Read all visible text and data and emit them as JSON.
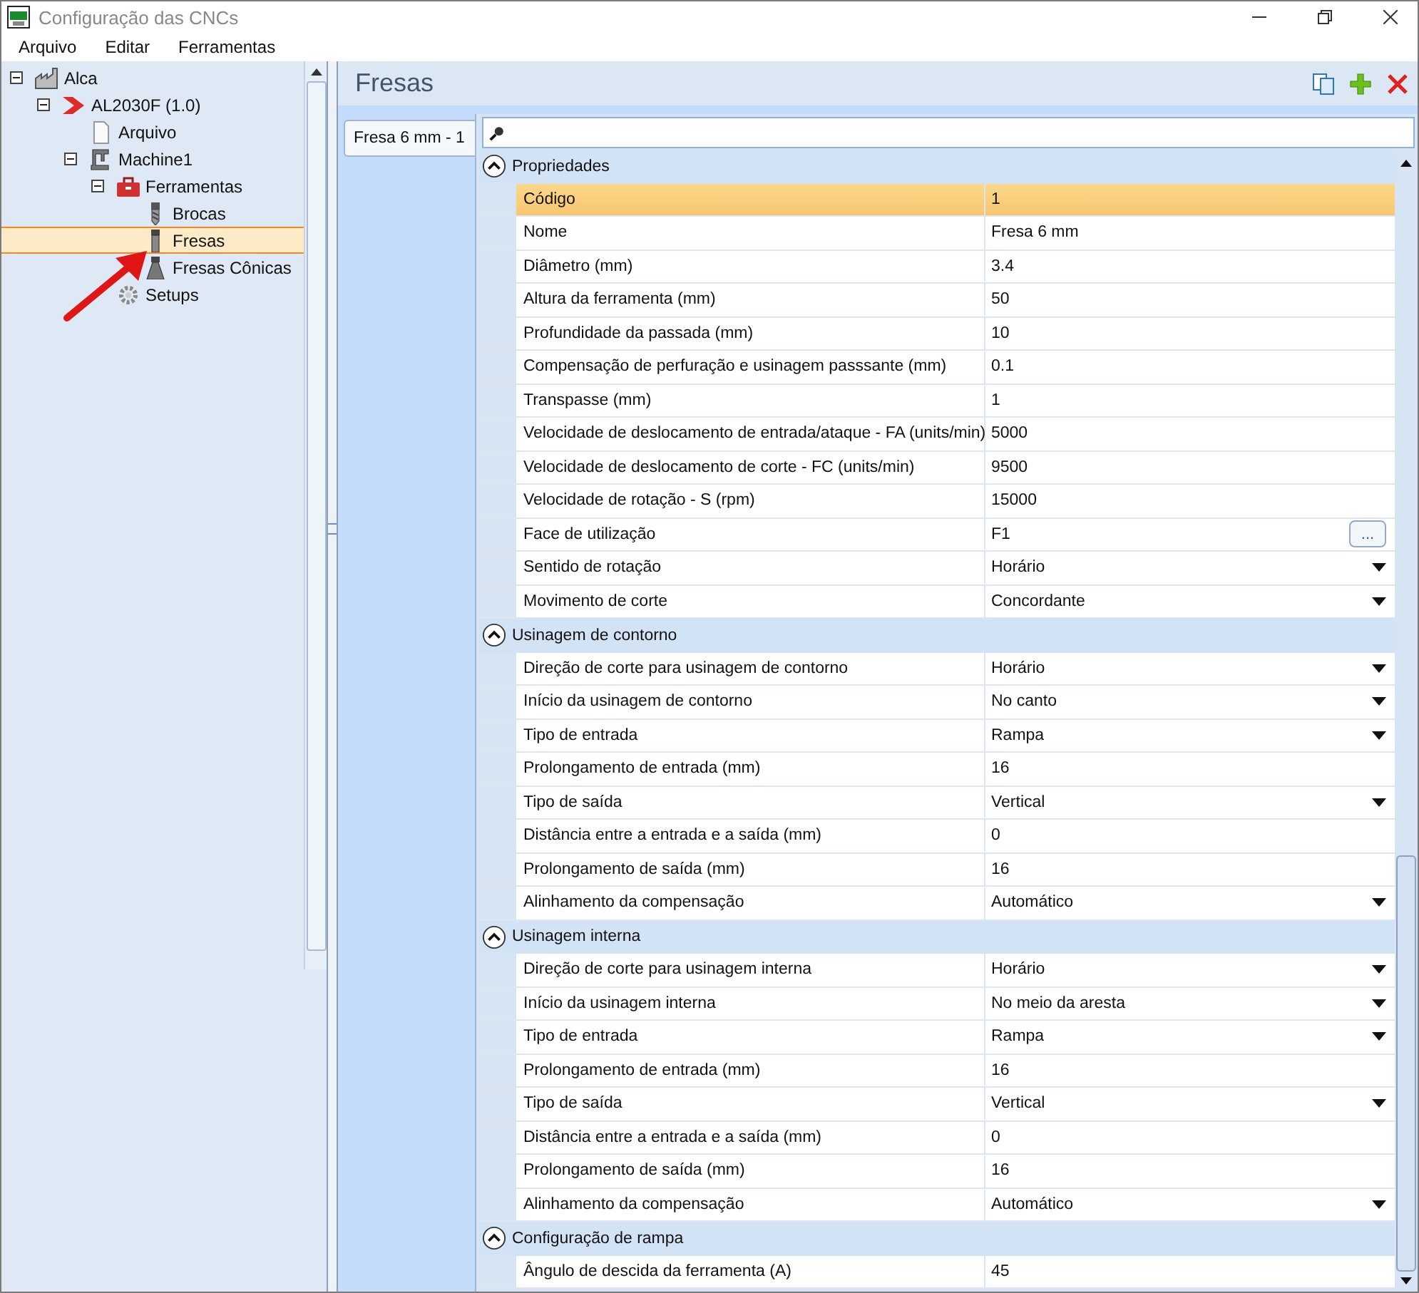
{
  "window": {
    "title": "Configuração das CNCs"
  },
  "menu": [
    "Arquivo",
    "Editar",
    "Ferramentas"
  ],
  "tree": [
    {
      "label": "Alca",
      "kind": "factory",
      "expanded": true,
      "selected": false,
      "children": [
        {
          "label": "AL2030F (1.0)",
          "kind": "chevron",
          "expanded": true,
          "selected": false,
          "children": [
            {
              "label": "Arquivo",
              "kind": "file",
              "selected": false
            },
            {
              "label": "Machine1",
              "kind": "machine",
              "expanded": true,
              "selected": false,
              "children": [
                {
                  "label": "Ferramentas",
                  "kind": "toolbox",
                  "expanded": true,
                  "selected": false,
                  "children": [
                    {
                      "label": "Brocas",
                      "kind": "drill",
                      "selected": false
                    },
                    {
                      "label": "Fresas",
                      "kind": "mill",
                      "selected": true
                    },
                    {
                      "label": "Fresas Cônicas",
                      "kind": "conical",
                      "selected": false
                    }
                  ]
                },
                {
                  "label": "Setups",
                  "kind": "gear",
                  "selected": false
                }
              ]
            }
          ]
        }
      ]
    }
  ],
  "panel": {
    "title": "Fresas",
    "tabs": [
      {
        "label": "Fresa 6 mm - 1",
        "selected": true
      }
    ]
  },
  "grid": {
    "sections": [
      {
        "title": "Propriedades",
        "expanded": true,
        "rows": [
          {
            "label": "Código",
            "value": "1",
            "kind": "text",
            "selected": true
          },
          {
            "label": "Nome",
            "value": "Fresa 6 mm",
            "kind": "text",
            "selected": false
          },
          {
            "label": "Diâmetro (mm)",
            "value": "3.4",
            "kind": "text",
            "selected": false
          },
          {
            "label": "Altura da ferramenta (mm)",
            "value": "50",
            "kind": "text",
            "selected": false
          },
          {
            "label": "Profundidade da passada (mm)",
            "value": "10",
            "kind": "text",
            "selected": false
          },
          {
            "label": "Compensação de perfuração e usinagem passsante (mm)",
            "value": "0.1",
            "kind": "text",
            "selected": false
          },
          {
            "label": "Transpasse (mm)",
            "value": "1",
            "kind": "text",
            "selected": false
          },
          {
            "label": "Velocidade de deslocamento de entrada/ataque - FA (units/min)",
            "value": "5000",
            "kind": "text",
            "selected": false
          },
          {
            "label": "Velocidade de deslocamento de corte - FC (units/min)",
            "value": "9500",
            "kind": "text",
            "selected": false
          },
          {
            "label": "Velocidade de rotação - S (rpm)",
            "value": "15000",
            "kind": "text",
            "selected": false
          },
          {
            "label": "Face de utilização",
            "value": "F1",
            "kind": "ellipsis",
            "button": "...",
            "selected": false
          },
          {
            "label": "Sentido de rotação",
            "value": "Horário",
            "kind": "dropdown",
            "selected": false
          },
          {
            "label": "Movimento de corte",
            "value": "Concordante",
            "kind": "dropdown",
            "selected": false
          }
        ]
      },
      {
        "title": "Usinagem de contorno",
        "expanded": true,
        "rows": [
          {
            "label": "Direção de corte para usinagem de contorno",
            "value": "Horário",
            "kind": "dropdown",
            "selected": false
          },
          {
            "label": "Início da usinagem de contorno",
            "value": "No canto",
            "kind": "dropdown",
            "selected": false
          },
          {
            "label": "Tipo de entrada",
            "value": "Rampa",
            "kind": "dropdown",
            "selected": false
          },
          {
            "label": "Prolongamento de entrada (mm)",
            "value": "16",
            "kind": "text",
            "selected": false
          },
          {
            "label": "Tipo de saída",
            "value": "Vertical",
            "kind": "dropdown",
            "selected": false
          },
          {
            "label": "Distância entre a entrada e a saída (mm)",
            "value": "0",
            "kind": "text",
            "selected": false
          },
          {
            "label": "Prolongamento de saída (mm)",
            "value": "16",
            "kind": "text",
            "selected": false
          },
          {
            "label": "Alinhamento da compensação",
            "value": "Automático",
            "kind": "dropdown",
            "selected": false
          }
        ]
      },
      {
        "title": "Usinagem interna",
        "expanded": true,
        "rows": [
          {
            "label": "Direção de corte para usinagem interna",
            "value": "Horário",
            "kind": "dropdown",
            "selected": false
          },
          {
            "label": "Início da usinagem interna",
            "value": "No meio da aresta",
            "kind": "dropdown",
            "selected": false
          },
          {
            "label": "Tipo de entrada",
            "value": "Rampa",
            "kind": "dropdown",
            "selected": false
          },
          {
            "label": "Prolongamento de entrada (mm)",
            "value": "16",
            "kind": "text",
            "selected": false
          },
          {
            "label": "Tipo de saída",
            "value": "Vertical",
            "kind": "dropdown",
            "selected": false
          },
          {
            "label": "Distância entre a entrada e a saída (mm)",
            "value": "0",
            "kind": "text",
            "selected": false
          },
          {
            "label": "Prolongamento de saída (mm)",
            "value": "16",
            "kind": "text",
            "selected": false
          },
          {
            "label": "Alinhamento da compensação",
            "value": "Automático",
            "kind": "dropdown",
            "selected": false
          }
        ]
      },
      {
        "title": "Configuração de rampa",
        "expanded": true,
        "rows": [
          {
            "label": "Ângulo de descida da ferramenta (A)",
            "value": "45",
            "kind": "text",
            "selected": false
          }
        ]
      }
    ]
  }
}
